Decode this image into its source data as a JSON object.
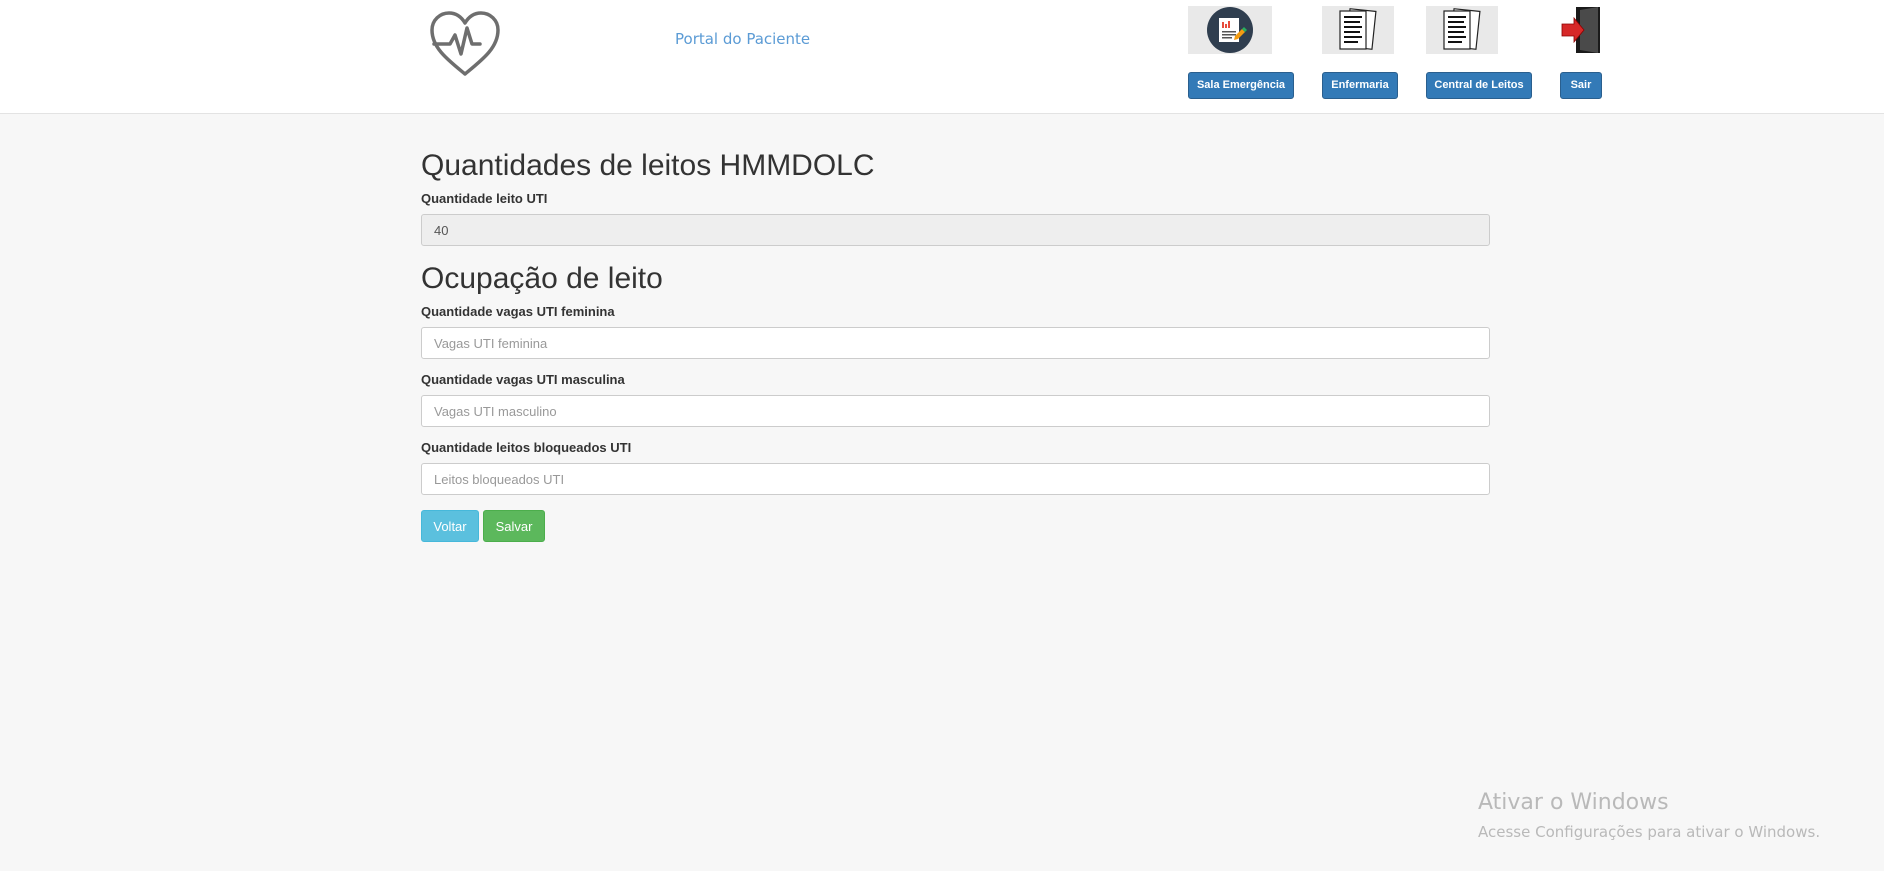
{
  "header": {
    "portal_title": "Portal do Paciente",
    "nav": [
      {
        "label": "Sala Emergência",
        "icon": "emergency-report-icon"
      },
      {
        "label": "Enfermaria",
        "icon": "documents-icon"
      },
      {
        "label": "Central de Leitos",
        "icon": "documents-icon"
      },
      {
        "label": "Sair",
        "icon": "exit-door-icon"
      }
    ]
  },
  "main": {
    "heading_beds": "Quantidades de leitos HMMDOLC",
    "uti_label": "Quantidade leito UTI",
    "uti_value": "40",
    "heading_occupancy": "Ocupação de leito",
    "female_label": "Quantidade vagas UTI feminina",
    "female_placeholder": "Vagas UTI feminina",
    "male_label": "Quantidade vagas UTI masculina",
    "male_placeholder": "Vagas UTI masculino",
    "blocked_label": "Quantidade leitos bloqueados UTI",
    "blocked_placeholder": "Leitos bloqueados UTI",
    "back_button": "Voltar",
    "save_button": "Salvar"
  },
  "watermark": {
    "title": "Ativar o Windows",
    "subtitle": "Acesse Configurações para ativar o Windows."
  },
  "colors": {
    "primary": "#337ab7",
    "info": "#5bc0de",
    "success": "#5cb85c",
    "link": "#5b9bd5"
  }
}
